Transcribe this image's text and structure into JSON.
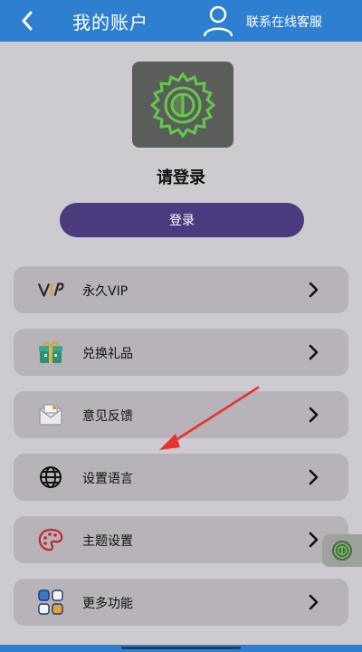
{
  "header": {
    "title": "我的账户",
    "contact": "联系在线客服"
  },
  "profile": {
    "prompt": "请登录",
    "login_button": "登录"
  },
  "menu": [
    {
      "label": "永久VIP",
      "icon": "vip-icon"
    },
    {
      "label": "兑换礼品",
      "icon": "gift-icon"
    },
    {
      "label": "意见反馈",
      "icon": "mail-icon"
    },
    {
      "label": "设置语言",
      "icon": "globe-icon"
    },
    {
      "label": "主题设置",
      "icon": "palette-icon"
    },
    {
      "label": "更多功能",
      "icon": "grid-icon"
    }
  ],
  "colors": {
    "header": "#2f7fd0",
    "accent": "#4c3a7e",
    "menu_bg": "#b7b3b9",
    "page_bg": "#cdcbd0",
    "annotation": "#e8322b"
  }
}
